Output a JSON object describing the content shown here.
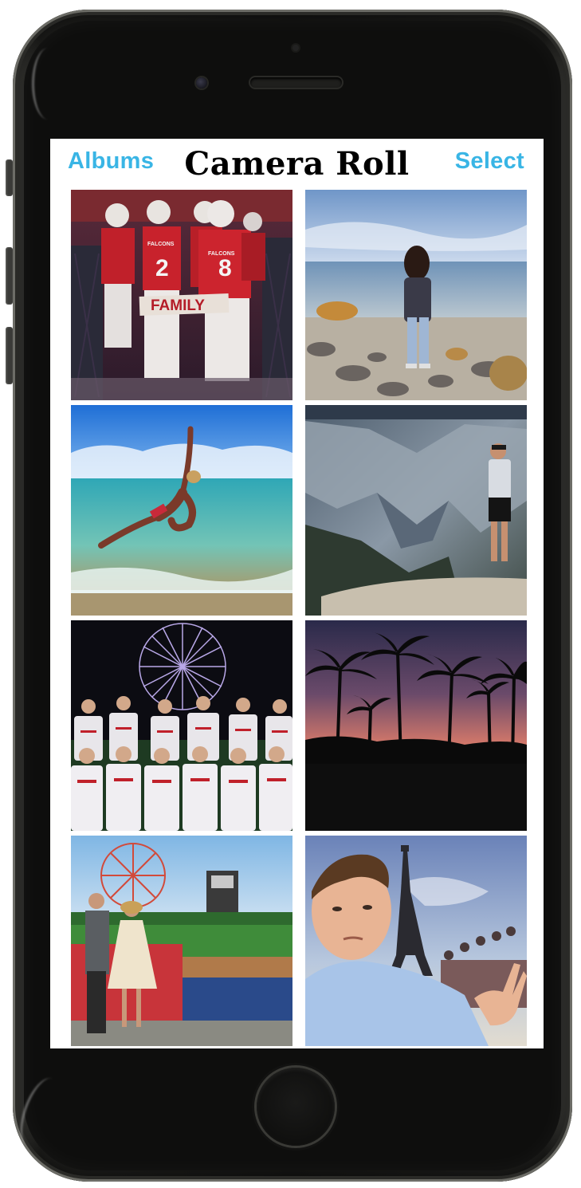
{
  "nav": {
    "left_label": "Albums",
    "title": "Camera Roll",
    "right_label": "Select"
  },
  "accent_color": "#39b5e5",
  "photos": [
    {
      "subject": "football players in red uniforms holding a FAMILY sign",
      "sign_text": "FAMILY"
    },
    {
      "subject": "person standing on a rocky beach"
    },
    {
      "subject": "dancer leaping above ocean waves"
    },
    {
      "subject": "person looking over a mountain canyon"
    },
    {
      "subject": "baseball team photo in front of a ferris wheel"
    },
    {
      "subject": "palm trees silhouetted at sunset"
    },
    {
      "subject": "couple in formal wear at a ballpark with ferris wheel"
    },
    {
      "subject": "selfie in front of the Eiffel Tower"
    }
  ]
}
